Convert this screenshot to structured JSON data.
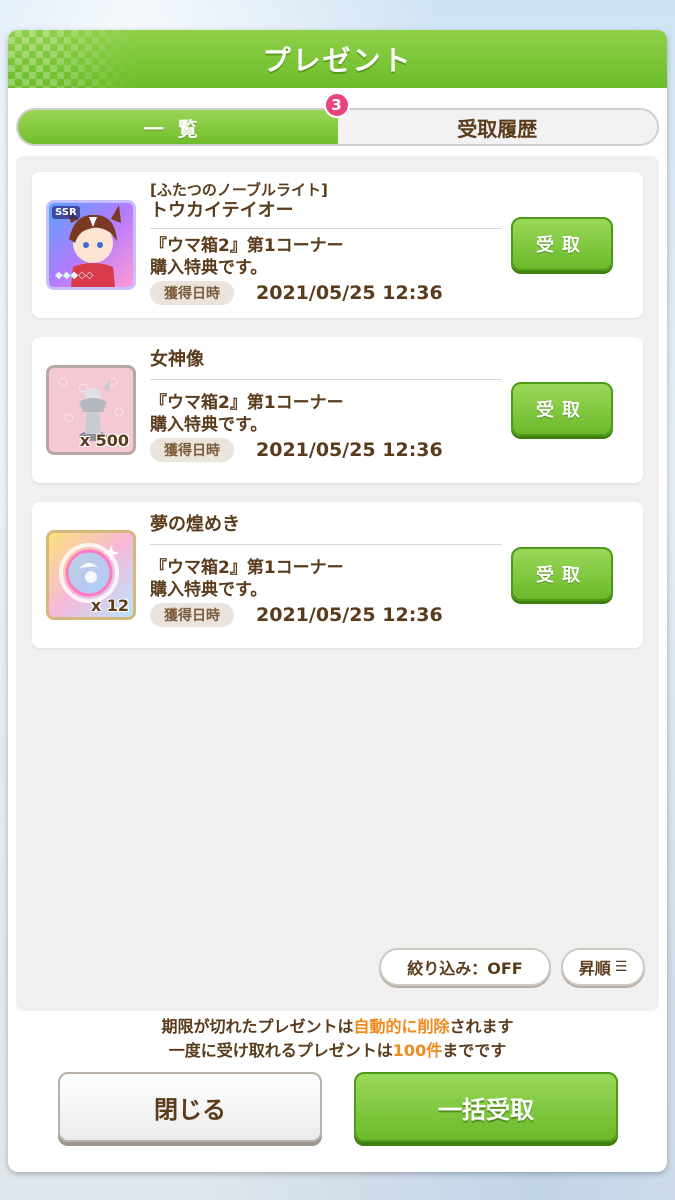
{
  "dialog": {
    "title": "プレゼント"
  },
  "tabs": [
    {
      "label": "一覧",
      "badge": "3",
      "active": true
    },
    {
      "label": "受取履歴",
      "active": false
    }
  ],
  "items": [
    {
      "icon": "ssr-character-card-icon",
      "icon_tag": "SSR",
      "quantity": "",
      "name_line1": "[ふたつのノーブルライト]",
      "name_line2": "トウカイテイオー",
      "desc_line1": "『ウマ箱2』第1コーナー",
      "desc_line2": "購入特典です。",
      "date_label": "獲得日時",
      "date": "2021/05/25 12:36",
      "claim_label": "受取"
    },
    {
      "icon": "goddess-statue-icon",
      "quantity": "x 500",
      "name_line1": "女神像",
      "desc_line1": "『ウマ箱2』第1コーナー",
      "desc_line2": "購入特典です。",
      "date_label": "獲得日時",
      "date": "2021/05/25 12:36",
      "claim_label": "受取"
    },
    {
      "icon": "dream-sparkle-icon",
      "quantity": "x 12",
      "name_line1": "夢の煌めき",
      "desc_line1": "『ウマ箱2』第1コーナー",
      "desc_line2": "購入特典です。",
      "date_label": "獲得日時",
      "date": "2021/05/25 12:36",
      "claim_label": "受取"
    }
  ],
  "filters": {
    "filter_label": "絞り込み：OFF",
    "sort_label": "昇順"
  },
  "notice": {
    "line1_pre": "期限が切れたプレゼントは",
    "line1_hl": "自動的に削除",
    "line1_post": "されます",
    "line2_pre": "一度に受け取れるプレゼントは",
    "line2_hl": "100件",
    "line2_post": "までです"
  },
  "buttons": {
    "close_label": "閉じる",
    "claim_all_label": "一括受取"
  },
  "colors": {
    "accent_green": "#6cbc2a",
    "text_brown": "#5a3b1c",
    "highlight_orange": "#f08a1c",
    "badge_pink": "#e8457a"
  }
}
